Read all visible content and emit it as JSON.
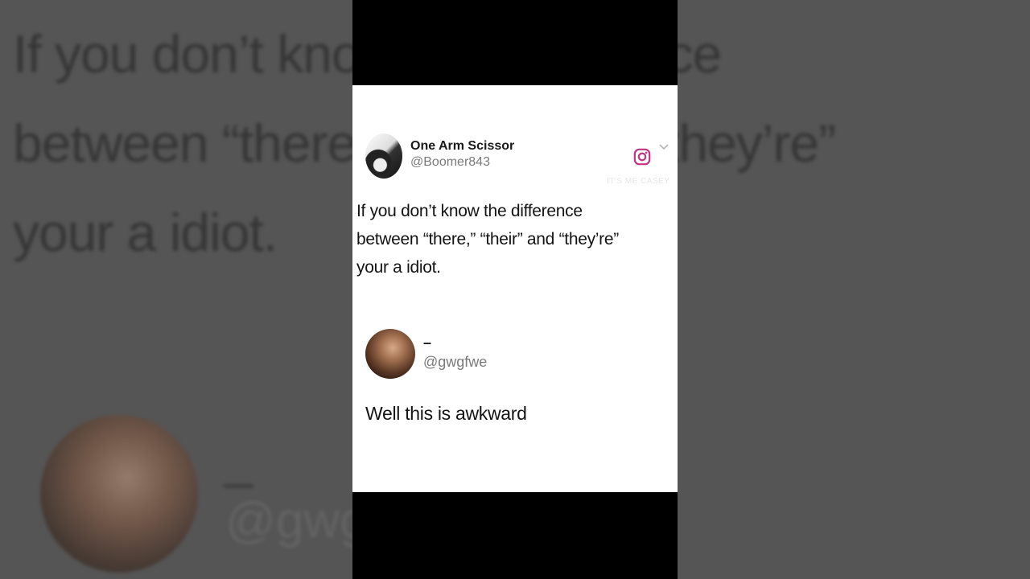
{
  "background": {
    "text": "If you don’t know the difference\nbetween “there,” “their” and “they’re”\nyour a idiot.",
    "reply_name": "–",
    "reply_handle": "@gwgfwe"
  },
  "tweet": {
    "author_name": "One Arm Scissor",
    "author_handle": "@Boomer843",
    "watermark": "IT'S ME CASEY",
    "text": "If you don’t know the difference\nbetween “there,” “their” and “they’re”\nyour a idiot."
  },
  "reply": {
    "author_name": "–",
    "author_handle": "@gwgfwe",
    "text": "Well this is awkward"
  },
  "icons": {
    "brand": "instagram-icon",
    "menu": "chevron-down-icon"
  },
  "colors": {
    "frame": "#000000",
    "card": "#ffffff",
    "instagram": "#c13584"
  }
}
